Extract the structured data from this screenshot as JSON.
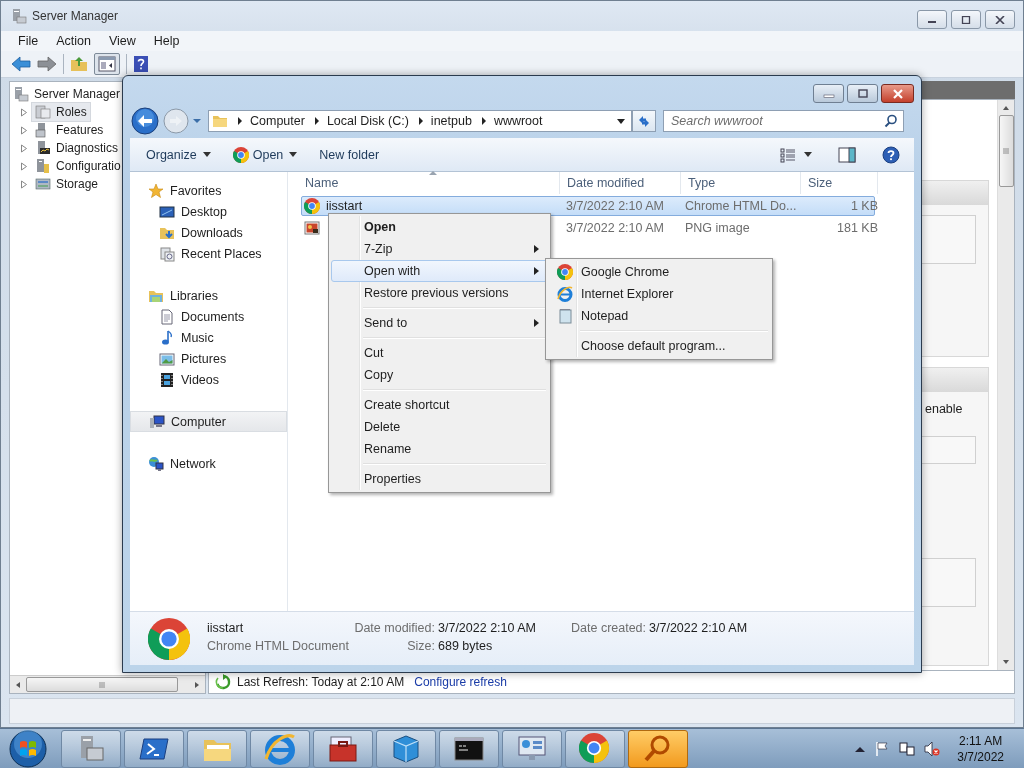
{
  "server_manager": {
    "title": "Server Manager",
    "menu": [
      "File",
      "Action",
      "View",
      "Help"
    ],
    "tree": {
      "label": "Server Manager",
      "children": [
        {
          "label": "Roles",
          "selected": true
        },
        {
          "label": "Features",
          "selected": false
        },
        {
          "label": "Diagnostics",
          "selected": false
        },
        {
          "label": "Configuratio",
          "selected": false
        },
        {
          "label": "Storage",
          "selected": false
        }
      ]
    },
    "pane_text": "enable",
    "refresh": {
      "text": "Last Refresh: Today at 2:10 AM",
      "link": "Configure refresh"
    }
  },
  "explorer": {
    "address": [
      "Computer",
      "Local Disk (C:)",
      "inetpub",
      "wwwroot"
    ],
    "search": {
      "placeholder": "Search wwwroot"
    },
    "commands": [
      {
        "label": "Organize",
        "dropdown": true
      },
      {
        "label": "Open",
        "dropdown": true
      },
      {
        "label": "New folder",
        "dropdown": false
      }
    ],
    "nav": [
      {
        "label": "Favorites",
        "selected": false,
        "items": [
          {
            "label": "Desktop",
            "selected": false
          },
          {
            "label": "Downloads",
            "selected": false
          },
          {
            "label": "Recent Places",
            "selected": false
          }
        ]
      },
      {
        "label": "Libraries",
        "selected": false,
        "items": [
          {
            "label": "Documents",
            "selected": false
          },
          {
            "label": "Music",
            "selected": false
          },
          {
            "label": "Pictures",
            "selected": false
          },
          {
            "label": "Videos",
            "selected": false
          }
        ]
      },
      {
        "label": "Computer",
        "selected": true
      },
      {
        "label": "Network",
        "selected": false
      }
    ],
    "columns": [
      "Name",
      "Date modified",
      "Type",
      "Size"
    ],
    "files": [
      {
        "name": "iisstart",
        "date": "3/7/2022 2:10 AM",
        "type": "Chrome HTML Do...",
        "size": "1 KB",
        "selected": true
      },
      {
        "date": "3/7/2022 2:10 AM",
        "type": "PNG image",
        "size": "181 KB",
        "selected": false
      }
    ],
    "details": {
      "name": "iisstart",
      "type": "Chrome HTML Document",
      "properties": [
        {
          "label": "Date modified:",
          "value": "3/7/2022 2:10 AM"
        },
        {
          "label": "Size:",
          "value": "689 bytes"
        },
        {
          "label": "Date created:",
          "value": "3/7/2022 2:10 AM"
        }
      ]
    }
  },
  "context_menu": {
    "items": [
      {
        "kind": "item",
        "label": "Open",
        "default": true,
        "submenu": false,
        "selected": false
      },
      {
        "kind": "item",
        "label": "7-Zip",
        "default": false,
        "submenu": true,
        "selected": false
      },
      {
        "kind": "item",
        "label": "Open with",
        "default": false,
        "submenu": true,
        "selected": true
      },
      {
        "kind": "item",
        "label": "Restore previous versions",
        "default": false,
        "submenu": false,
        "selected": false
      },
      {
        "kind": "separator"
      },
      {
        "kind": "item",
        "label": "Send to",
        "default": false,
        "submenu": true,
        "selected": false
      },
      {
        "kind": "separator"
      },
      {
        "kind": "item",
        "label": "Cut",
        "default": false,
        "submenu": false,
        "selected": false
      },
      {
        "kind": "item",
        "label": "Copy",
        "default": false,
        "submenu": false,
        "selected": false
      },
      {
        "kind": "separator"
      },
      {
        "kind": "item",
        "label": "Create shortcut",
        "default": false,
        "submenu": false,
        "selected": false
      },
      {
        "kind": "item",
        "label": "Delete",
        "default": false,
        "submenu": false,
        "selected": false
      },
      {
        "kind": "item",
        "label": "Rename",
        "default": false,
        "submenu": false,
        "selected": false
      },
      {
        "kind": "separator"
      },
      {
        "kind": "item",
        "label": "Properties",
        "default": false,
        "submenu": false,
        "selected": false
      }
    ]
  },
  "submenu": {
    "items": [
      {
        "kind": "item",
        "label": "Google Chrome",
        "selected": false
      },
      {
        "kind": "item",
        "label": "Internet Explorer",
        "selected": false
      },
      {
        "kind": "item",
        "label": "Notepad",
        "selected": false
      },
      {
        "kind": "separator"
      },
      {
        "kind": "item",
        "label": "Choose default program...",
        "selected": false
      }
    ]
  },
  "taskbar": {
    "buttons": [
      {
        "selected": false
      },
      {
        "selected": false
      },
      {
        "selected": false
      },
      {
        "selected": false
      },
      {
        "selected": false
      },
      {
        "selected": false
      },
      {
        "selected": false
      },
      {
        "selected": false
      },
      {
        "selected": false
      },
      {
        "selected": true
      }
    ],
    "clock": {
      "time": "2:11 AM",
      "date": "3/7/2022"
    }
  }
}
